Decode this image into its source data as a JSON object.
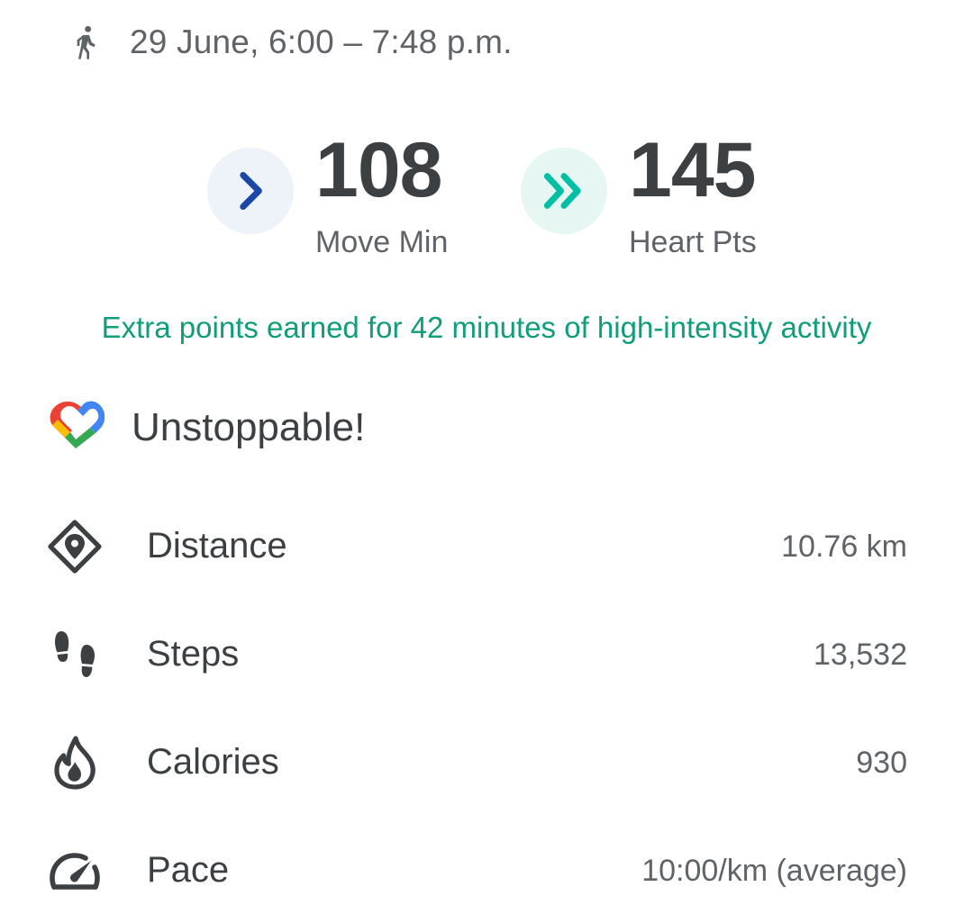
{
  "header": {
    "date_range": "29 June, 6:00 – 7:48 p.m.",
    "icon": "walking-icon"
  },
  "metrics": {
    "move": {
      "value": "108",
      "label": "Move Min",
      "icon": "chevron-right-icon",
      "color": "#1a47a8"
    },
    "heart": {
      "value": "145",
      "label": "Heart Pts",
      "icon": "double-chevron-right-icon",
      "color": "#00bfa5"
    }
  },
  "extra_points_text": "Extra points earned for 42 minutes of high-intensity activity",
  "achievement": {
    "title": "Unstoppable!",
    "icon": "google-fit-heart-icon"
  },
  "stats": [
    {
      "label": "Distance",
      "value": "10.76 km",
      "icon": "location-diamond-icon"
    },
    {
      "label": "Steps",
      "value": "13,532",
      "icon": "footsteps-icon"
    },
    {
      "label": "Calories",
      "value": "930",
      "icon": "flame-icon"
    },
    {
      "label": "Pace",
      "value": "10:00/km (average)",
      "icon": "speedometer-icon"
    }
  ],
  "colors": {
    "accent_green": "#0f9d7a",
    "text_primary": "#3c4043",
    "text_secondary": "#5f6368"
  }
}
